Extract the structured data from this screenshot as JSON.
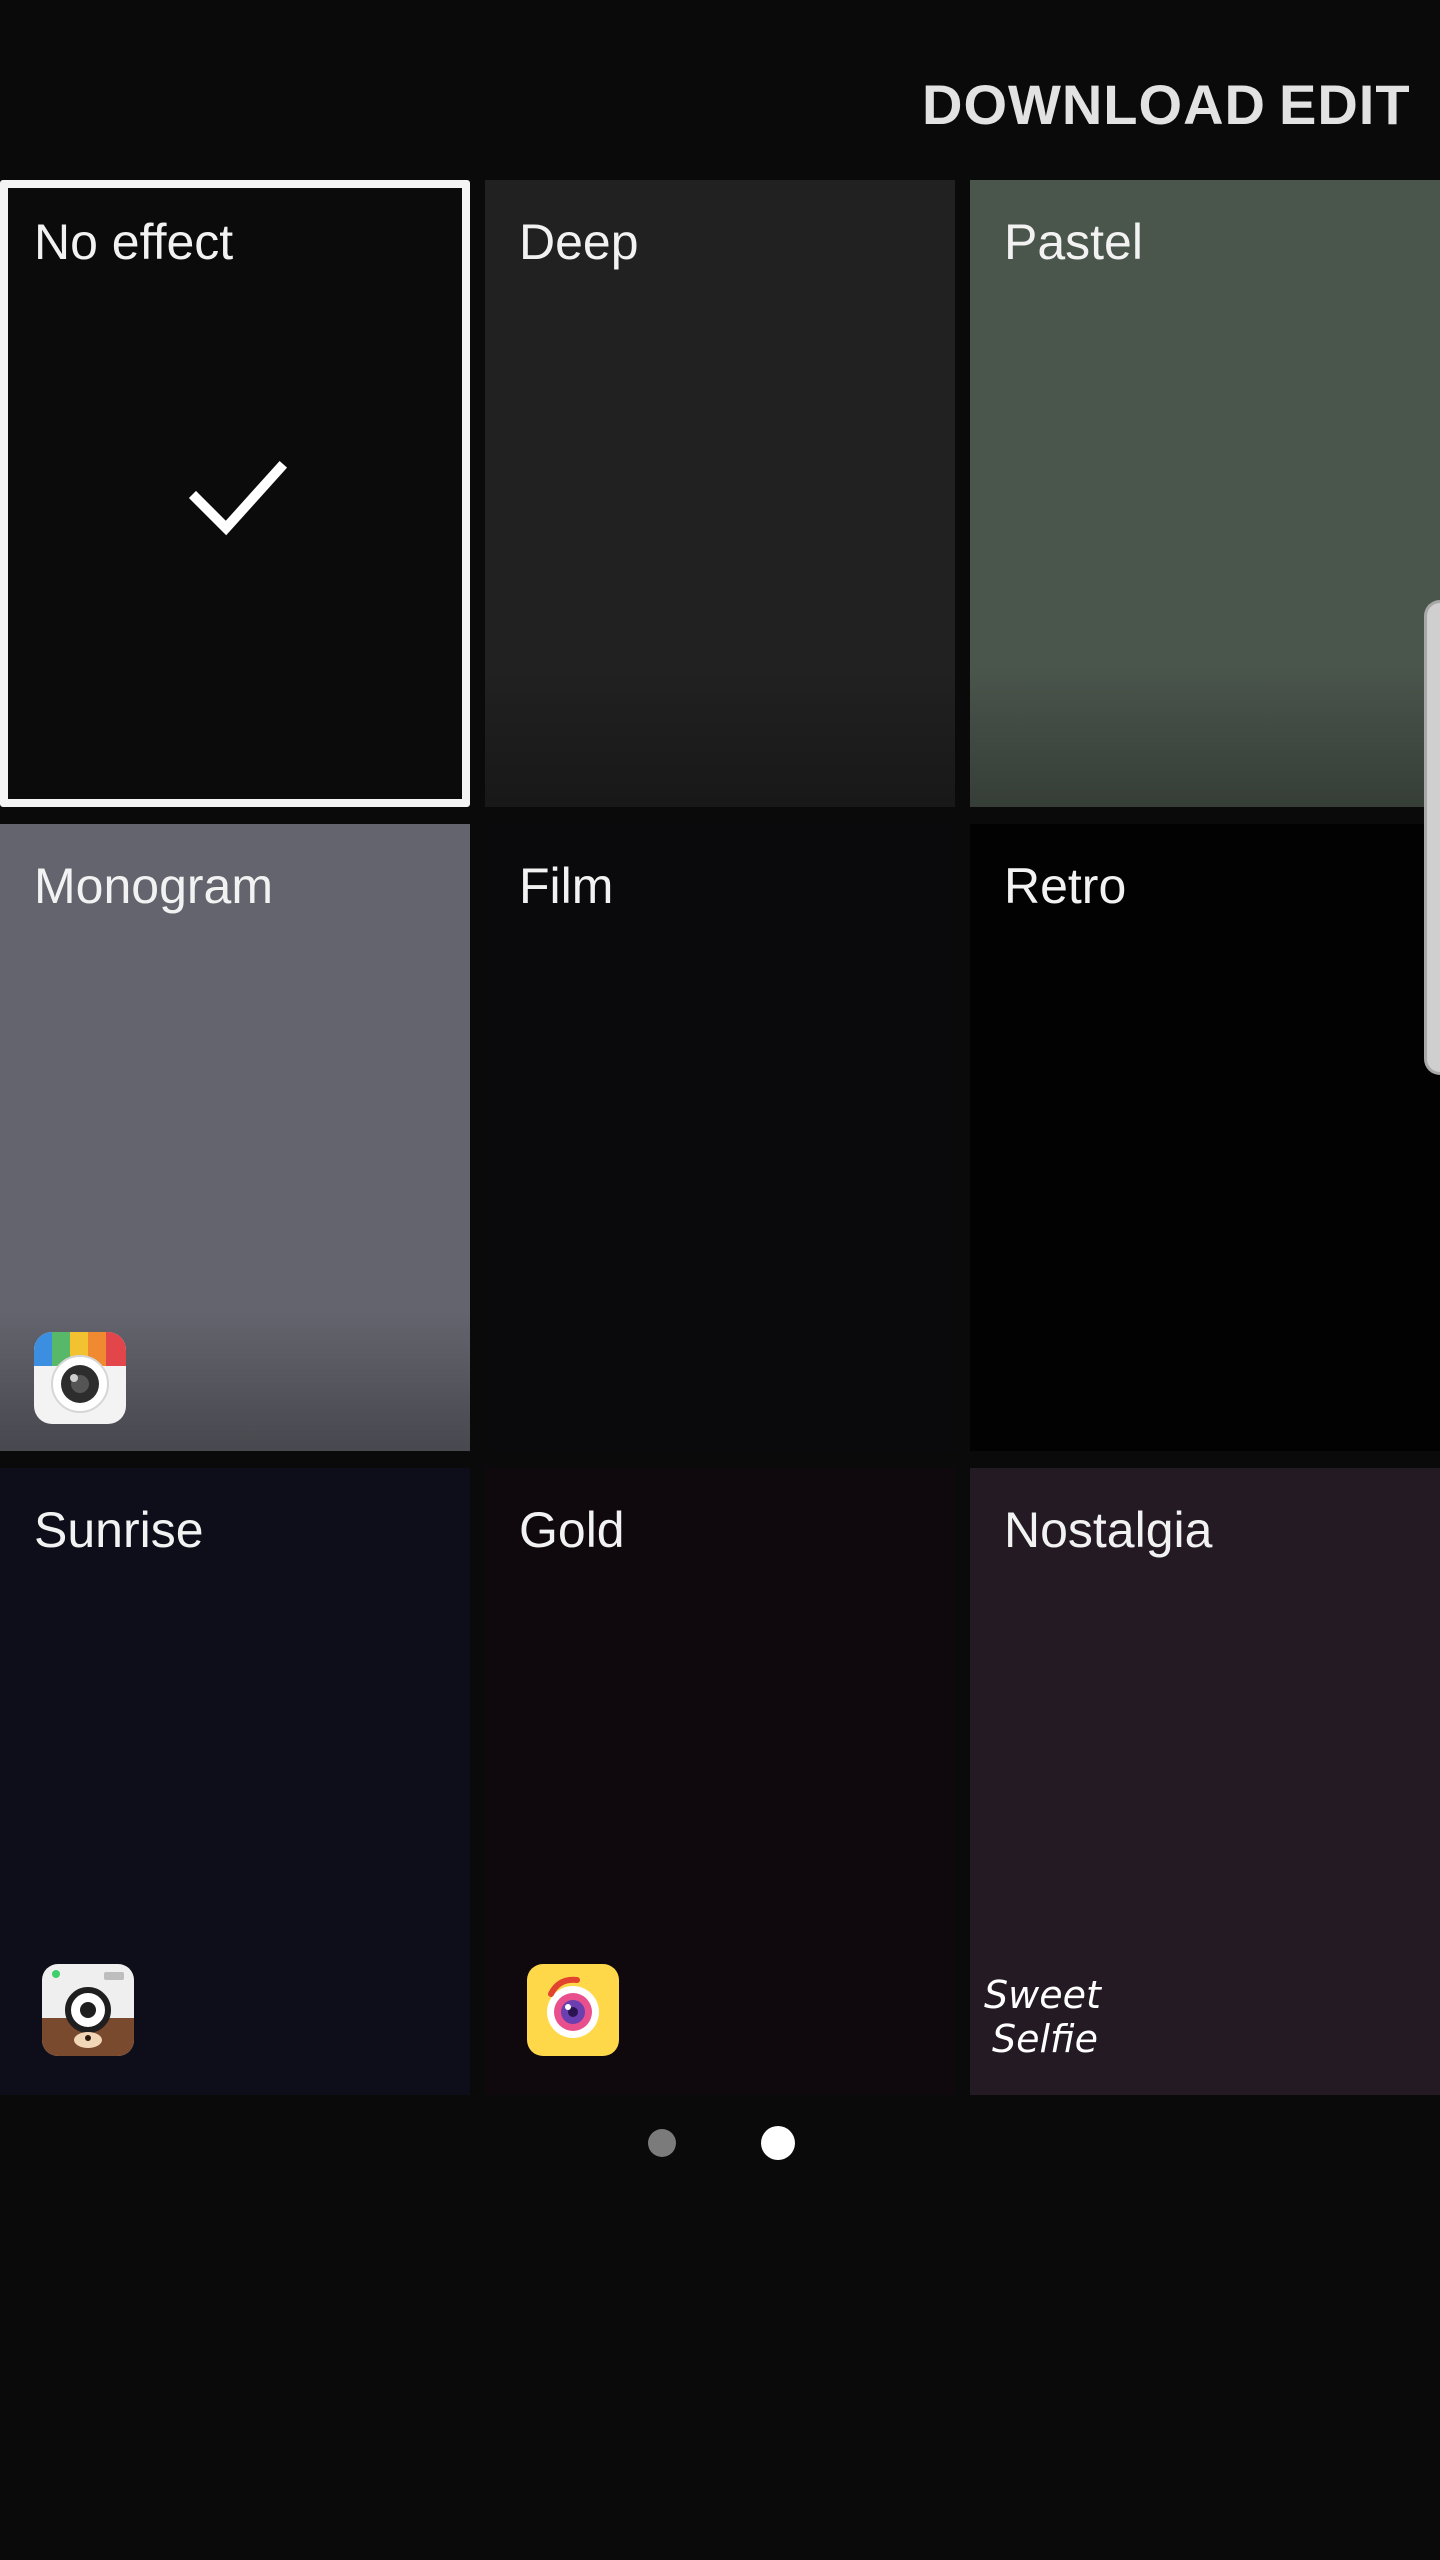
{
  "topbar": {
    "download_label": "DOWNLOAD",
    "edit_label": "EDIT"
  },
  "effects": [
    {
      "label": "No effect",
      "selected": true,
      "bg": "#0b0b0c"
    },
    {
      "label": "Deep",
      "selected": false,
      "bg": "#212121"
    },
    {
      "label": "Pastel",
      "selected": false,
      "bg": "#4a554c"
    },
    {
      "label": "Monogram",
      "selected": false,
      "bg": "#63646d",
      "app_icon": "retrica-camera-icon"
    },
    {
      "label": "Film",
      "selected": false,
      "bg": "#0a090c"
    },
    {
      "label": "Retro",
      "selected": false,
      "bg": "#020202"
    },
    {
      "label": "Sunrise",
      "selected": false,
      "bg": "#0d0e1a",
      "app_icon": "line-camera-bear-icon"
    },
    {
      "label": "Gold",
      "selected": false,
      "bg": "#0f080c",
      "app_icon": "camera360-icon"
    },
    {
      "label": "Nostalgia",
      "selected": false,
      "bg": "#231a24",
      "app_icon": "sweet-selfie-logo",
      "app_text": [
        "Sweet",
        "Selfie"
      ]
    }
  ],
  "pager": {
    "total": 2,
    "active_index": 1
  },
  "colors": {
    "background": "#0a0a0b",
    "action_text": "#e2e2e2",
    "selected_border": "#f4f4f4"
  }
}
